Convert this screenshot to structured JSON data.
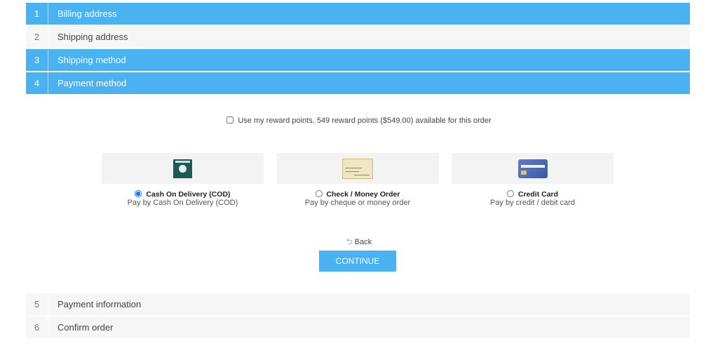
{
  "steps_top": [
    {
      "num": "1",
      "label": "Billing address",
      "state": "active"
    },
    {
      "num": "2",
      "label": "Shipping address",
      "state": "inactive"
    },
    {
      "num": "3",
      "label": "Shipping method",
      "state": "active"
    },
    {
      "num": "4",
      "label": "Payment method",
      "state": "active"
    }
  ],
  "steps_bottom": [
    {
      "num": "5",
      "label": "Payment information",
      "state": "inactive"
    },
    {
      "num": "6",
      "label": "Confirm order",
      "state": "inactive"
    }
  ],
  "reward": {
    "label": "Use my reward points, 549 reward points ($549.00) available for this order",
    "checked": false
  },
  "payment_methods": [
    {
      "name": "Cash On Delivery (COD)",
      "description": "Pay by Cash On Delivery (COD)",
      "selected": true,
      "logo": "cod-logo-icon"
    },
    {
      "name": "Check / Money Order",
      "description": "Pay by cheque or money order",
      "selected": false,
      "logo": "check-logo-icon"
    },
    {
      "name": "Credit Card",
      "description": "Pay by credit / debit card",
      "selected": false,
      "logo": "credit-card-logo-icon"
    }
  ],
  "actions": {
    "back_label": "Back",
    "back_icon": "back-arrow-icon",
    "continue_label": "CONTINUE"
  },
  "colors": {
    "accent": "#4ab2f1",
    "inactive_bg": "#f6f6f6"
  }
}
